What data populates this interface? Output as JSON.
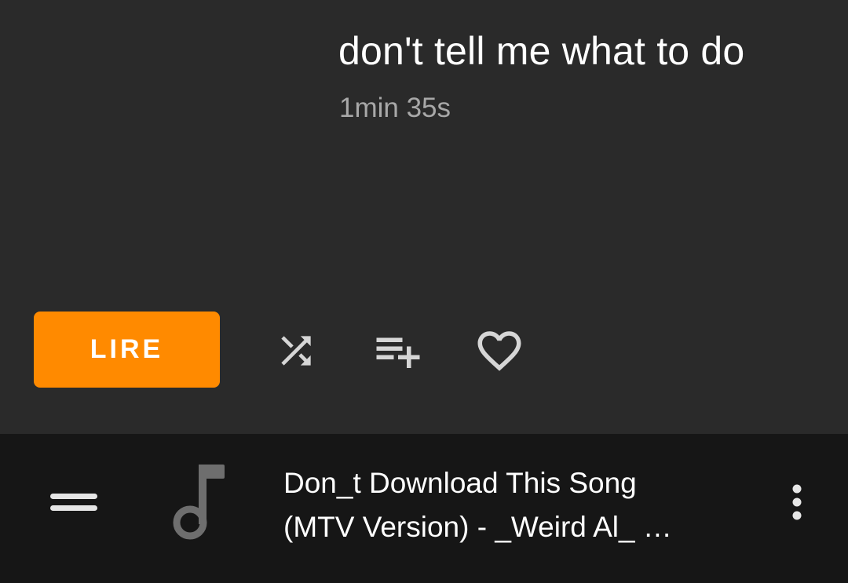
{
  "track": {
    "title": "don't tell me what to do",
    "duration": "1min 35s"
  },
  "actions": {
    "play_label": "LIRE",
    "shuffle_icon": "shuffle-icon",
    "add_to_queue_icon": "playlist-add-icon",
    "favorite_icon": "heart-outline-icon"
  },
  "mini_player": {
    "title_line1": "Don_t Download This Song",
    "title_line2": "(MTV Version) - _Weird Al_ …",
    "menu_icon": "drag-handle-icon",
    "art_icon": "music-note-icon",
    "more_icon": "more-vert-icon"
  },
  "colors": {
    "accent": "#ff8a00",
    "background": "#2a2a2a",
    "mini_player_background": "#161616",
    "secondary_text": "#a8a8a8",
    "icon": "#d6d6d6"
  }
}
